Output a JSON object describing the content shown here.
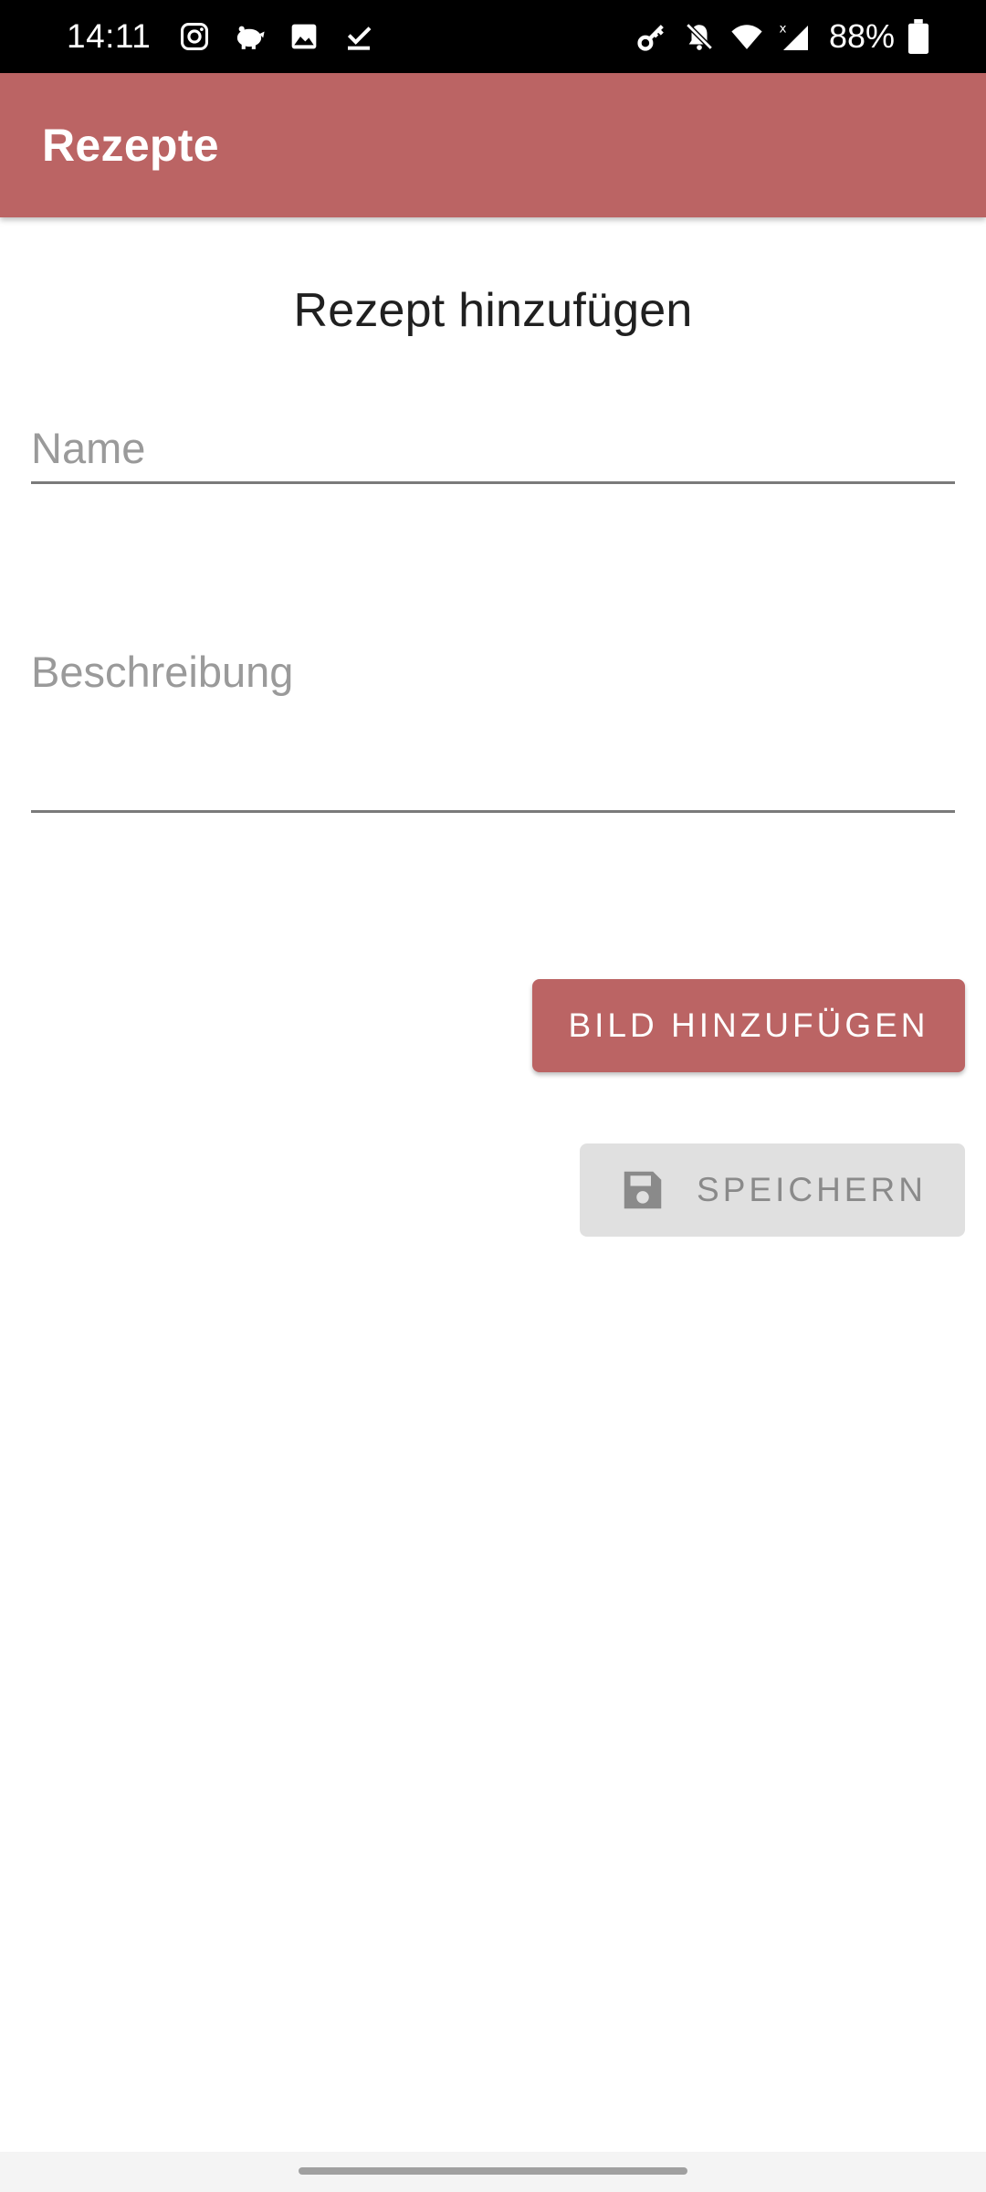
{
  "status_bar": {
    "time": "14:11",
    "battery": "88%",
    "left_icons": [
      "instagram-icon",
      "piggy-bank-icon",
      "image-icon",
      "check-download-icon"
    ],
    "right_icons": [
      "key-icon",
      "bell-off-icon",
      "wifi-icon",
      "signal-icon",
      "battery-icon"
    ]
  },
  "app_bar": {
    "title": "Rezepte",
    "color": "#bb6464"
  },
  "form": {
    "heading": "Rezept hinzufügen",
    "name_placeholder": "Name",
    "description_placeholder": "Beschreibung",
    "add_image_label": "BILD HINZUFÜGEN",
    "save_label": "SPEICHERN",
    "save_icon": "floppy-disk-icon"
  }
}
